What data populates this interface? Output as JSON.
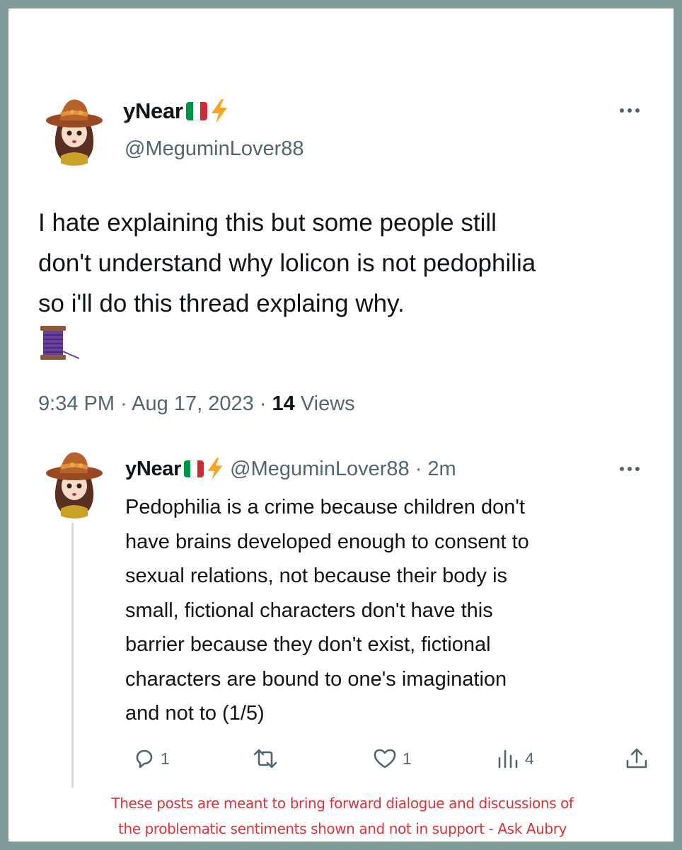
{
  "tweet": {
    "display_name": "yNear",
    "handle": "@MeguminLover88",
    "body": "I hate explaining this but some people still\ndon't understand why lolicon is not pedophilia\nso i'll do this thread explaing why.",
    "thread_emoji_icon": "spool-of-thread-icon",
    "time": "9:34 PM",
    "separator": " · ",
    "date": "Aug 17, 2023",
    "views_count": "14",
    "views_label": " Views"
  },
  "reply": {
    "display_name": "yNear",
    "handle_time": "@MeguminLover88 · 2m",
    "body": "Pedophilia is a crime because children don't\nhave brains developed enough to consent to\nsexual relations, not because their body is\nsmall, fictional characters don't have this\nbarrier because they don't exist, fictional\ncharacters are bound to one's imagination\nand not to (1/5)",
    "actions": {
      "reply_count": "1",
      "retweet_count": "",
      "like_count": "1",
      "views_count": "4"
    }
  },
  "disclaimer": "These posts are meant to bring forward dialogue and discussions of\nthe problematic sentiments shown and not in support - Ask Aubry",
  "colors": {
    "border": "#819a9a",
    "text_primary": "#0f1419",
    "text_secondary": "#536471",
    "disclaimer": "#d8323a",
    "flag_green": "#009246",
    "flag_white": "#ffffff",
    "flag_red": "#ce2b37"
  }
}
